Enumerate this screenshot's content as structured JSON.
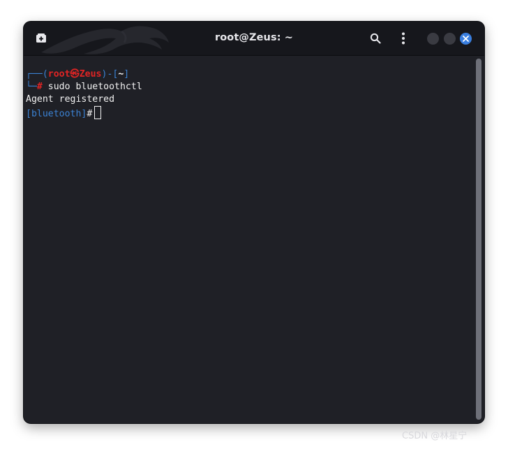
{
  "window": {
    "title": "root@Zeus: ~"
  },
  "header": {
    "new_tab_icon": "new-tab-icon",
    "search_icon": "search-icon",
    "menu_icon": "kebab-menu-icon",
    "close_icon": "close-icon"
  },
  "terminal": {
    "prompt": {
      "corner_top": "┌──",
      "open_paren": "(",
      "user": "root",
      "at_symbol": "㉿",
      "host": "Zeus",
      "close_paren_dash": ")-[",
      "path": "~",
      "close_bracket": "]",
      "corner_bottom": "└─",
      "hash": "#",
      "command": " sudo bluetoothctl"
    },
    "output": "Agent registered",
    "bt_prompt": "[bluetooth]",
    "bt_hash": "#"
  },
  "colors": {
    "background": "#1f2026",
    "titlebar": "#16171c",
    "prompt_blue": "#3b82d4",
    "prompt_red": "#e02424",
    "close_button": "#3a7fe0"
  },
  "watermark": "CSDN @林星宁"
}
